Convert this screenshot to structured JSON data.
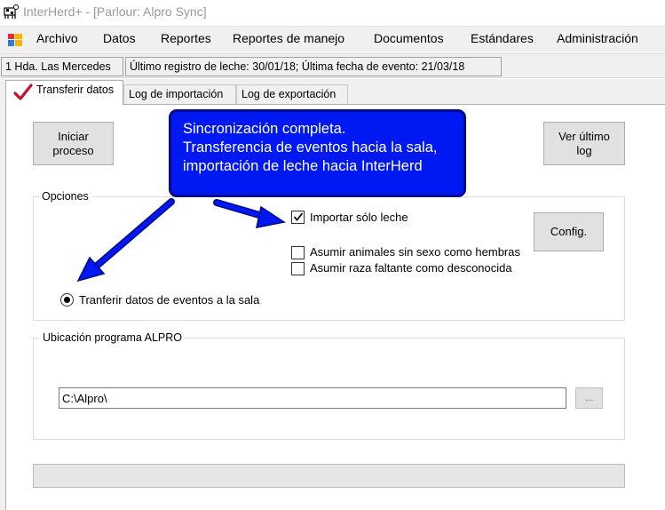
{
  "window": {
    "title": "InterHerd+ - [Parlour: Alpro Sync]",
    "app_icon": "cow-app-icon"
  },
  "menu": {
    "items": [
      "Archivo",
      "Datos",
      "Reportes",
      "Reportes de manejo",
      "Documentos",
      "Estándares",
      "Administración"
    ]
  },
  "status": {
    "herd": "1 Hda. Las Mercedes",
    "info": "Último registro de leche: 30/01/18; Última fecha de evento: 21/03/18"
  },
  "tabs": [
    {
      "label": "Transferir datos",
      "active": true
    },
    {
      "label": "Log de importación",
      "active": false
    },
    {
      "label": "Log de exportación",
      "active": false
    }
  ],
  "buttons": {
    "start": [
      "Iniciar",
      "proceso"
    ],
    "view_log": [
      "Ver último",
      "log"
    ],
    "config": "Config."
  },
  "options": {
    "group_label": "Opciones",
    "import_milk_only": {
      "label": "Importar sólo leche",
      "checked": true
    },
    "assume_female": {
      "label": "Asumir animales sin sexo como hembras",
      "checked": false
    },
    "assume_unknown_breed": {
      "label": "Asumir raza faltante como desconocida",
      "checked": false
    },
    "transfer_events": {
      "label": "Tranferir datos de eventos a la sala",
      "selected": true
    }
  },
  "location": {
    "group_label": "Ubicación programa ALPRO",
    "path": "C:\\Alpro\\",
    "browse_label": "..."
  },
  "progress": {
    "value": 0
  },
  "callout": {
    "lines": [
      "Sincronización completa.",
      "Transferencia de eventos hacia la sala,",
      "importación de leche hacia InterHerd"
    ]
  },
  "colors": {
    "callout_fill": "#0018f2",
    "arrow": "#0018f2",
    "checkmark_tab": "#c8102e"
  }
}
